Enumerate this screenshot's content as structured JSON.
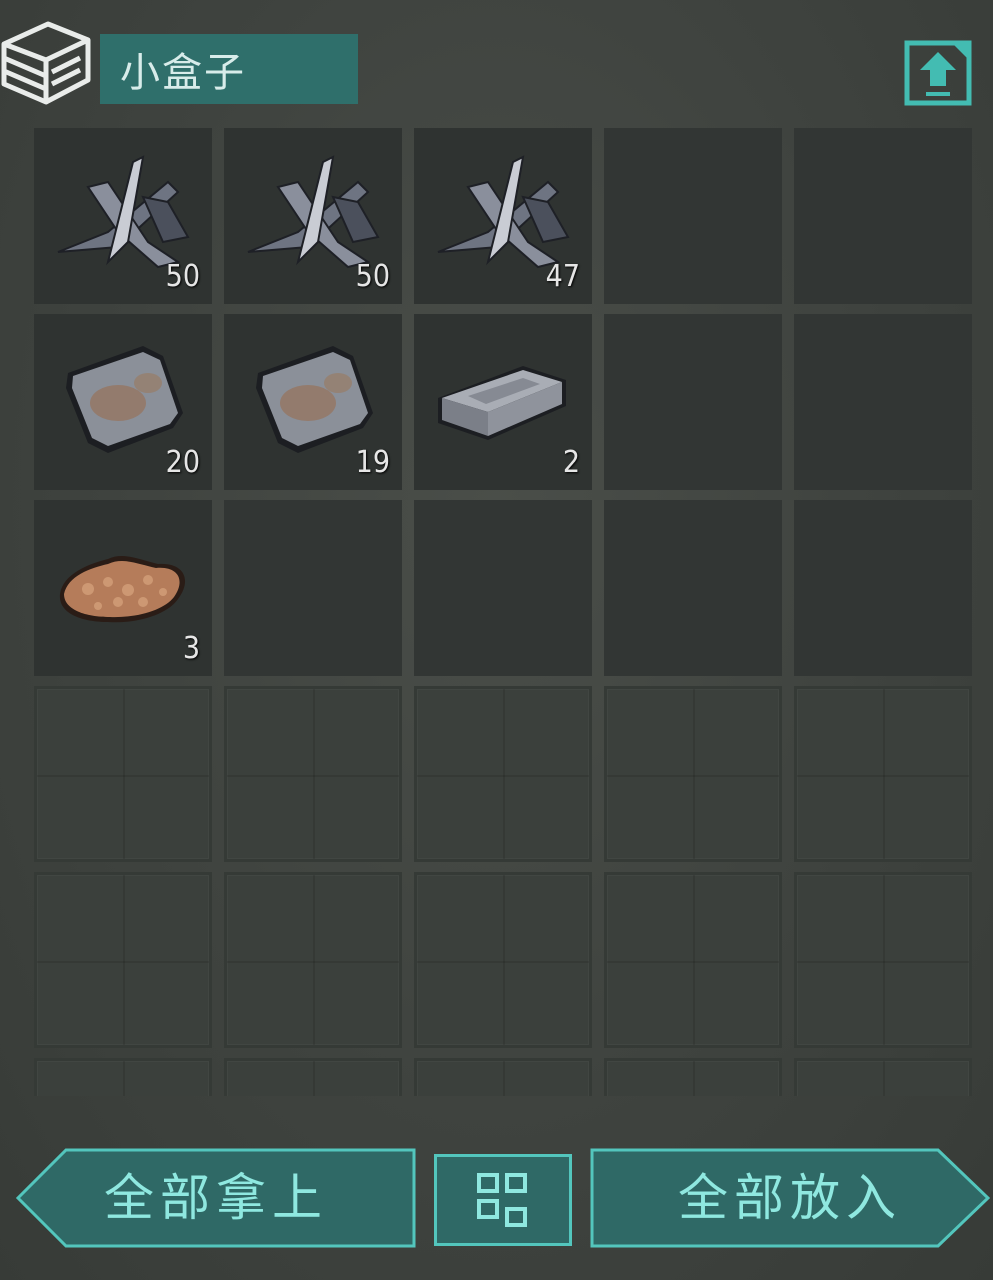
{
  "container": {
    "title": "小盒子"
  },
  "slots": [
    {
      "item": "metal-shards-icon",
      "qty": "50"
    },
    {
      "item": "metal-shards-icon",
      "qty": "50"
    },
    {
      "item": "metal-shards-icon",
      "qty": "47"
    },
    {
      "item": null,
      "qty": ""
    },
    {
      "item": null,
      "qty": ""
    },
    {
      "item": "metal-plate-icon",
      "qty": "20"
    },
    {
      "item": "metal-plate-icon",
      "qty": "19"
    },
    {
      "item": "metal-ingot-icon",
      "qty": "2"
    },
    {
      "item": null,
      "qty": ""
    },
    {
      "item": null,
      "qty": ""
    },
    {
      "item": "iron-ore-icon",
      "qty": "3"
    }
  ],
  "buttons": {
    "take_all": "全部拿上",
    "put_all": "全部放入"
  },
  "colors": {
    "accent": "#2f6f6b",
    "accent_light": "#8fe8e0",
    "panel_bg": "#404440"
  }
}
